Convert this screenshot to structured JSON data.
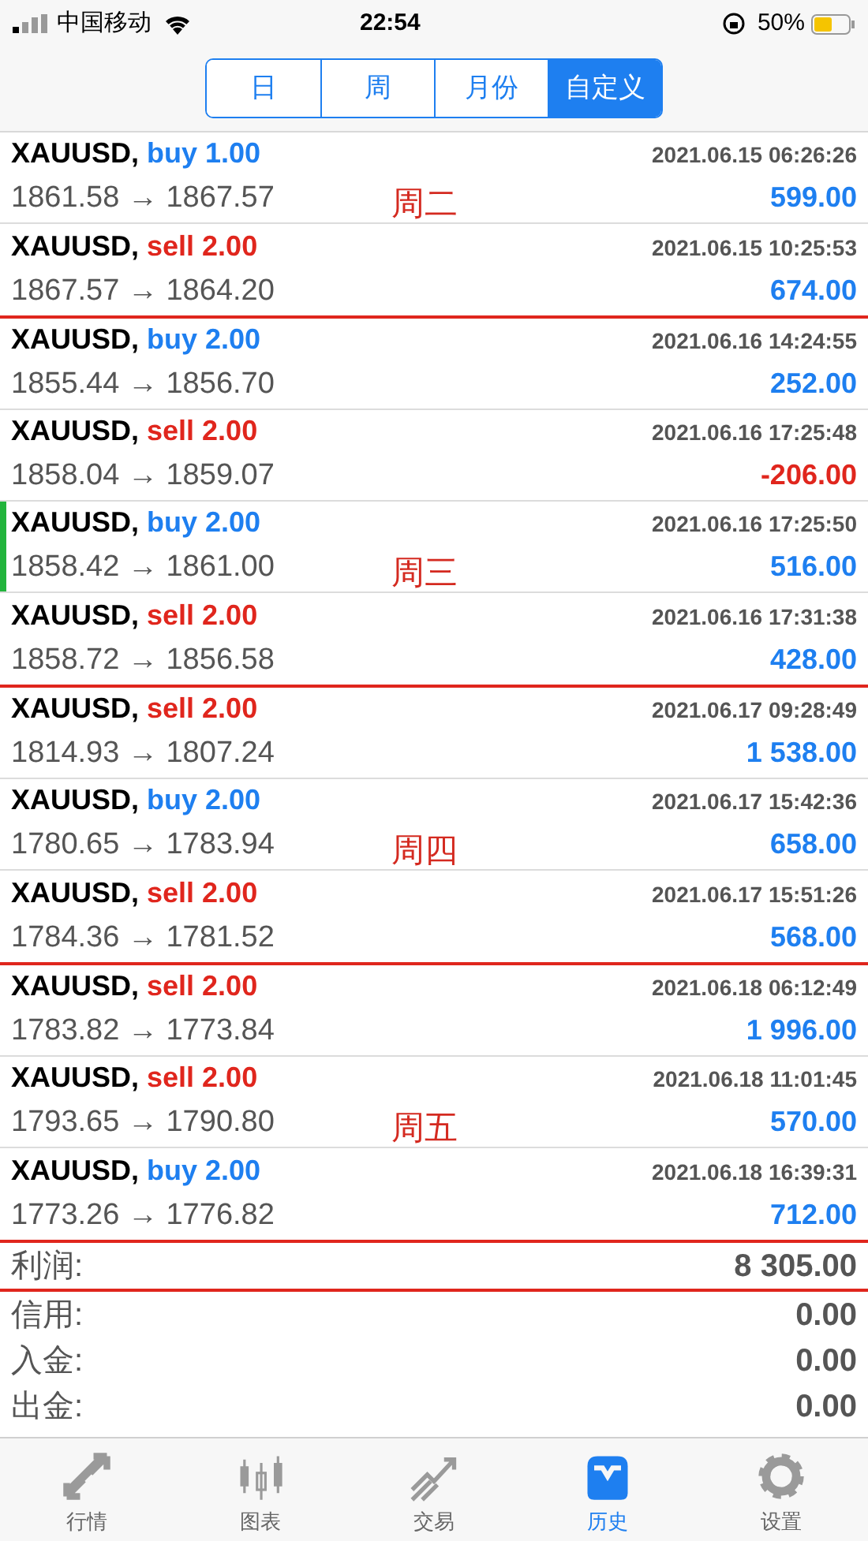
{
  "status_bar": {
    "carrier": "中国移动",
    "time": "22:54",
    "battery": "50%"
  },
  "tabs": [
    {
      "label": "日",
      "selected": false
    },
    {
      "label": "周",
      "selected": false
    },
    {
      "label": "月份",
      "selected": false
    },
    {
      "label": "自定义",
      "selected": true
    }
  ],
  "trades": [
    {
      "symbol": "XAUUSD,",
      "order": "buy 1.00",
      "kind": "buy",
      "time": "2021.06.15 06:26:26",
      "prices": "1861.58 → 1867.57",
      "profit": "599.00",
      "loss": false,
      "selected": false,
      "note": "周二",
      "red_line_below": false
    },
    {
      "symbol": "XAUUSD,",
      "order": "sell 2.00",
      "kind": "sell",
      "time": "2021.06.15 10:25:53",
      "prices": "1867.57 → 1864.20",
      "profit": "674.00",
      "loss": false,
      "selected": false,
      "red_line_below": true
    },
    {
      "symbol": "XAUUSD,",
      "order": "buy 2.00",
      "kind": "buy",
      "time": "2021.06.16 14:24:55",
      "prices": "1855.44 → 1856.70",
      "profit": "252.00",
      "loss": false,
      "selected": false,
      "red_line_below": false
    },
    {
      "symbol": "XAUUSD,",
      "order": "sell 2.00",
      "kind": "sell",
      "time": "2021.06.16 17:25:48",
      "prices": "1858.04 → 1859.07",
      "profit": "-206.00",
      "loss": true,
      "selected": false,
      "red_line_below": false
    },
    {
      "symbol": "XAUUSD,",
      "order": "buy 2.00",
      "kind": "buy",
      "time": "2021.06.16 17:25:50",
      "prices": "1858.42 → 1861.00",
      "profit": "516.00",
      "loss": false,
      "selected": true,
      "note": "周三",
      "red_line_below": false
    },
    {
      "symbol": "XAUUSD,",
      "order": "sell 2.00",
      "kind": "sell",
      "time": "2021.06.16 17:31:38",
      "prices": "1858.72 → 1856.58",
      "profit": "428.00",
      "loss": false,
      "selected": false,
      "red_line_below": true
    },
    {
      "symbol": "XAUUSD,",
      "order": "sell 2.00",
      "kind": "sell",
      "time": "2021.06.17 09:28:49",
      "prices": "1814.93 → 1807.24",
      "profit": "1 538.00",
      "loss": false,
      "selected": false,
      "red_line_below": false
    },
    {
      "symbol": "XAUUSD,",
      "order": "buy 2.00",
      "kind": "buy",
      "time": "2021.06.17 15:42:36",
      "prices": "1780.65 → 1783.94",
      "profit": "658.00",
      "loss": false,
      "selected": false,
      "note": "周四",
      "red_line_below": false
    },
    {
      "symbol": "XAUUSD,",
      "order": "sell 2.00",
      "kind": "sell",
      "time": "2021.06.17 15:51:26",
      "prices": "1784.36 → 1781.52",
      "profit": "568.00",
      "loss": false,
      "selected": false,
      "red_line_below": true
    },
    {
      "symbol": "XAUUSD,",
      "order": "sell 2.00",
      "kind": "sell",
      "time": "2021.06.18 06:12:49",
      "prices": "1783.82 → 1773.84",
      "profit": "1 996.00",
      "loss": false,
      "selected": false,
      "red_line_below": false
    },
    {
      "symbol": "XAUUSD,",
      "order": "sell 2.00",
      "kind": "sell",
      "time": "2021.06.18 11:01:45",
      "prices": "1793.65 → 1790.80",
      "profit": "570.00",
      "loss": false,
      "selected": false,
      "note": "周五",
      "red_line_below": false
    },
    {
      "symbol": "XAUUSD,",
      "order": "buy 2.00",
      "kind": "buy",
      "time": "2021.06.18 16:39:31",
      "prices": "1773.26 → 1776.82",
      "profit": "712.00",
      "loss": false,
      "selected": false,
      "red_line_below": true
    }
  ],
  "summary": [
    {
      "label": "利润:",
      "value": "8 305.00",
      "red_line_below": true
    },
    {
      "label": "信用:",
      "value": "0.00",
      "red_line_below": false
    },
    {
      "label": "入金:",
      "value": "0.00",
      "red_line_below": false
    },
    {
      "label": "出金:",
      "value": "0.00",
      "red_line_below": false
    }
  ],
  "bottom_tabs": [
    {
      "label": "行情",
      "kind": "quotes",
      "selected": false
    },
    {
      "label": "图表",
      "kind": "chart",
      "selected": false
    },
    {
      "label": "交易",
      "kind": "trade",
      "selected": false
    },
    {
      "label": "历史",
      "kind": "history",
      "selected": true
    },
    {
      "label": "设置",
      "kind": "settings",
      "selected": false
    }
  ]
}
